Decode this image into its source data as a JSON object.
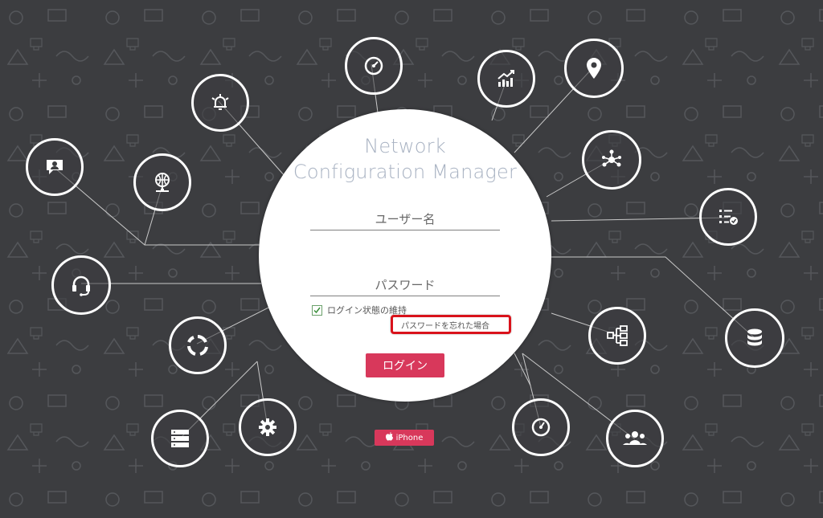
{
  "app": {
    "title_line1": "Network",
    "title_line2": "Configuration Manager"
  },
  "form": {
    "username_placeholder": "ユーザー名",
    "password_placeholder": "パスワード",
    "remember_label": "ログイン状態の維持",
    "remember_checked": true,
    "forgot_link": "パスワードを忘れた場合",
    "login_button": "ログイン"
  },
  "mobile": {
    "iphone_label": "iPhone"
  },
  "colors": {
    "accent": "#d8385b",
    "highlight_box": "#d9121b",
    "background": "#3c3d40",
    "title": "#a8b2c2"
  },
  "icons": [
    "speedometer-icon",
    "bell-icon",
    "trend-chart-icon",
    "location-pin-icon",
    "chat-support-icon",
    "globe-network-icon",
    "network-share-icon",
    "checklist-icon",
    "headset-icon",
    "refresh-cycle-icon",
    "workflow-icon",
    "database-icon",
    "server-icon",
    "gear-icon",
    "gauge-icon",
    "users-group-icon"
  ]
}
